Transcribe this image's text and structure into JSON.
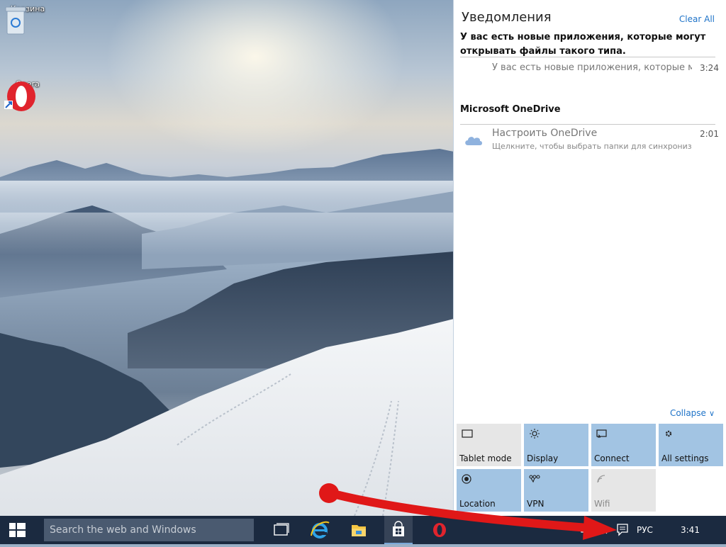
{
  "desktop": {
    "icons": [
      {
        "name": "recycle-bin",
        "label": "Корзина"
      },
      {
        "name": "opera",
        "label": "Opera"
      }
    ]
  },
  "action_center": {
    "title": "Уведомления",
    "clear_all": "Clear All",
    "notification_heading": "У вас есть новые приложения, которые могут открывать файлы такого типа.",
    "notification_text": "У вас есть новые приложения, которые м",
    "notification_time": "3:24",
    "group_title": "Microsoft OneDrive",
    "onedrive_title": "Настроить OneDrive",
    "onedrive_subtitle": "Щелкните, чтобы выбрать папки для синхронизац",
    "onedrive_time": "2:01",
    "collapse": "Collapse",
    "tiles": [
      {
        "label": "Tablet mode",
        "icon": "tablet-icon",
        "state": "off"
      },
      {
        "label": "Display",
        "icon": "brightness-icon",
        "state": "on"
      },
      {
        "label": "Connect",
        "icon": "connect-icon",
        "state": "on"
      },
      {
        "label": "All settings",
        "icon": "gear-icon",
        "state": "on"
      },
      {
        "label": "Location",
        "icon": "location-icon",
        "state": "on"
      },
      {
        "label": "VPN",
        "icon": "vpn-icon",
        "state": "on"
      },
      {
        "label": "Wifi",
        "icon": "wifi-icon",
        "state": "disabled"
      }
    ]
  },
  "taskbar": {
    "search_placeholder": "Search the web and Windows",
    "language": "РУС",
    "clock": "3:41",
    "apps": [
      "task-view",
      "internet-explorer",
      "file-explorer",
      "store",
      "opera"
    ]
  },
  "colors": {
    "accent": "#1e73c8",
    "tile_on": "#a2c4e3",
    "tile_off": "#e6e6e6",
    "taskbar": "#1b2a40",
    "annotation_arrow": "#e01818"
  }
}
